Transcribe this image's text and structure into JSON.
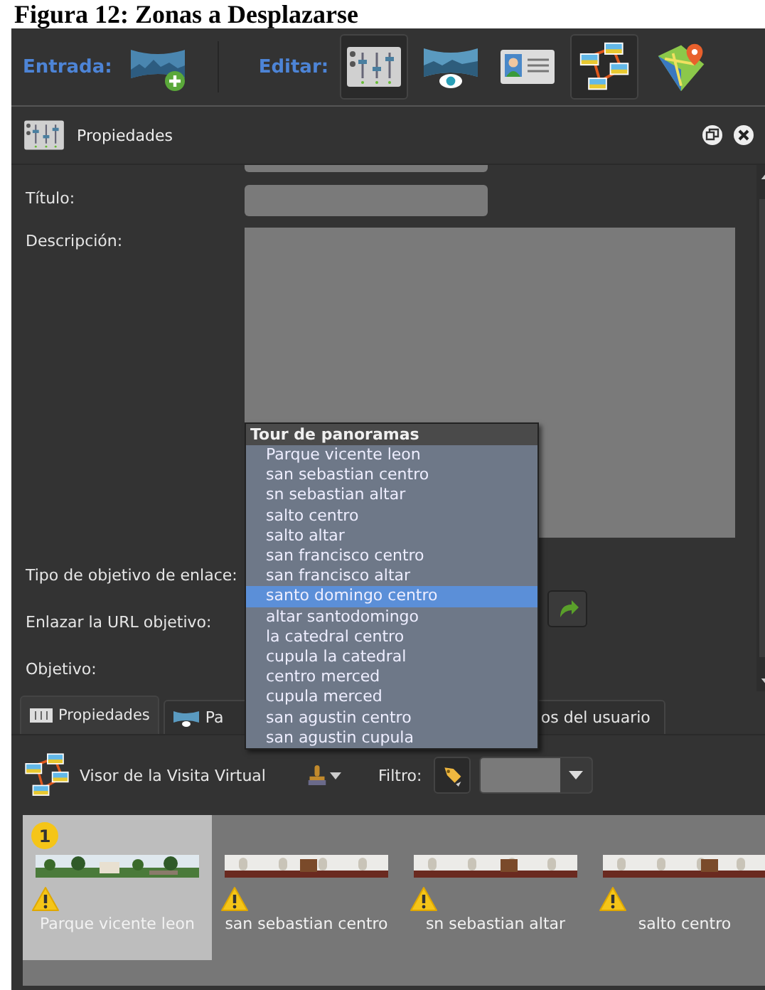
{
  "heading": "Figura 12: Zonas a Desplazarse",
  "toolbar": {
    "input_label": "Entrada:",
    "input_tools": [
      {
        "kind": "add-panorama",
        "pressed": false
      }
    ],
    "edit_label": "Editar:",
    "edit_tools": [
      {
        "kind": "sliders",
        "pressed": true
      },
      {
        "kind": "viewer",
        "pressed": false
      },
      {
        "kind": "card",
        "pressed": false
      },
      {
        "kind": "tour",
        "pressed": true
      },
      {
        "kind": "map",
        "pressed": false
      }
    ]
  },
  "panel": {
    "title": "Propiedades",
    "fields": [
      {
        "label": "Título:",
        "kind": "text"
      },
      {
        "label": "Descripción:",
        "kind": "textarea"
      },
      {
        "label": "Tipo de objetivo de enlace:",
        "kind": "empty"
      },
      {
        "label": "Enlazar la URL objetivo:",
        "kind": "button"
      },
      {
        "label": "Objetivo:",
        "kind": "empty"
      }
    ]
  },
  "dropdown": {
    "header": "Tour de panoramas",
    "items": [
      {
        "label": "Parque vicente leon",
        "selected": false
      },
      {
        "label": "san sebastian centro",
        "selected": false
      },
      {
        "label": "sn sebastian altar",
        "selected": false
      },
      {
        "label": "salto centro",
        "selected": false
      },
      {
        "label": "salto altar",
        "selected": false
      },
      {
        "label": "san francisco centro",
        "selected": false
      },
      {
        "label": "san francisco altar",
        "selected": false
      },
      {
        "label": "santo domingo centro",
        "selected": true
      },
      {
        "label": "altar santodomingo",
        "selected": false
      },
      {
        "label": "la catedral centro",
        "selected": false
      },
      {
        "label": "cupula la catedral",
        "selected": false
      },
      {
        "label": "centro merced",
        "selected": false
      },
      {
        "label": "cupula merced",
        "selected": false
      },
      {
        "label": "san agustin centro",
        "selected": false
      },
      {
        "label": "san agustin cupula",
        "selected": false
      }
    ]
  },
  "tabs": [
    {
      "label": "Propiedades",
      "selected": true
    },
    {
      "label": "Pa",
      "selected": false
    },
    {
      "label": "os del usuario",
      "selected": false
    }
  ],
  "viewer": {
    "title": "Visor de la Visita Virtual",
    "filter_label": "Filtro:",
    "panoramas": [
      {
        "label": "Parque vicente leon",
        "selected": true,
        "badge": "1",
        "warning": true
      },
      {
        "label": "san sebastian centro",
        "selected": false,
        "warning": true
      },
      {
        "label": "sn sebastian altar",
        "selected": false,
        "warning": true
      },
      {
        "label": "salto centro",
        "selected": false,
        "warning": true
      }
    ]
  }
}
